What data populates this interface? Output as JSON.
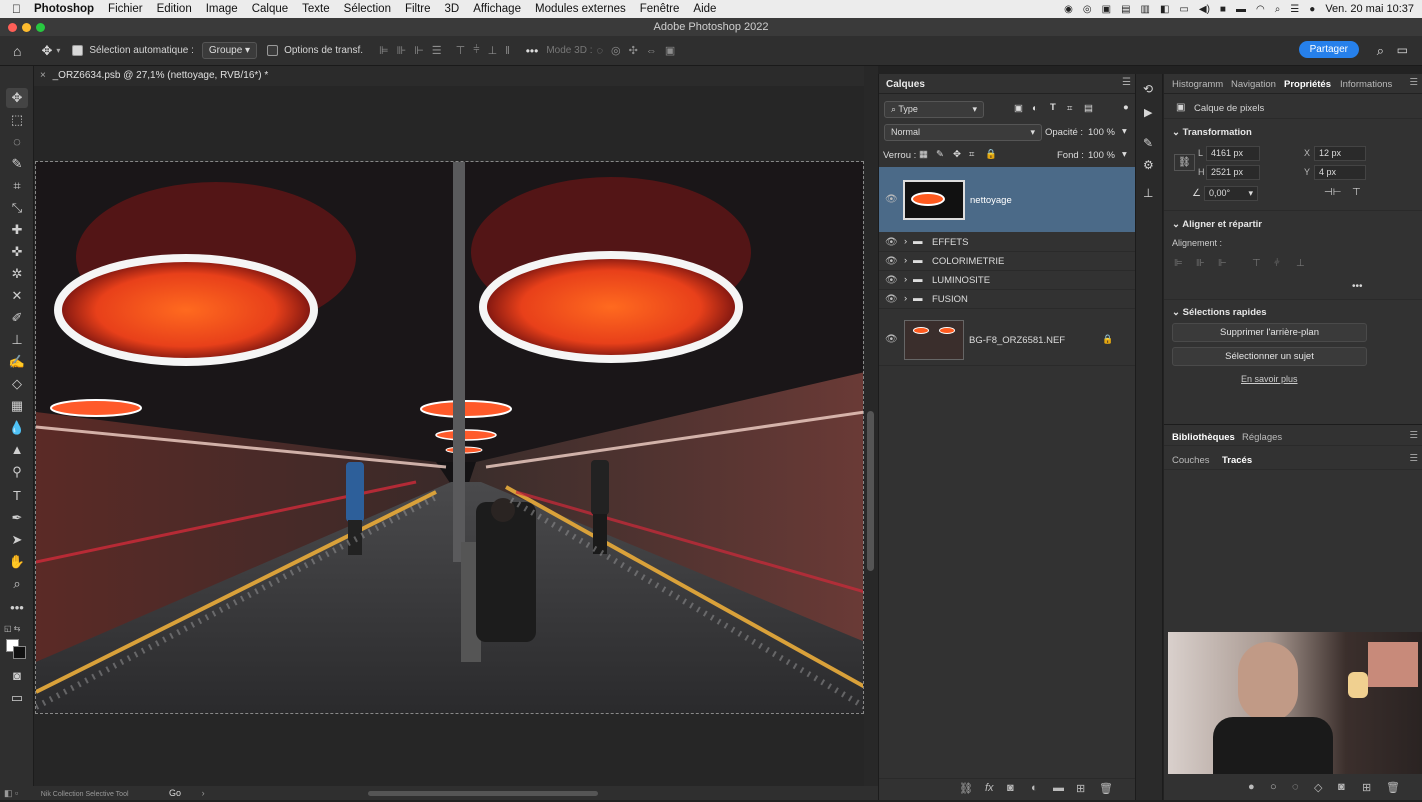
{
  "menubar": {
    "app": "Photoshop",
    "items": [
      "Fichier",
      "Edition",
      "Image",
      "Calque",
      "Texte",
      "Sélection",
      "Filtre",
      "3D",
      "Affichage",
      "Modules externes",
      "Fenêtre",
      "Aide"
    ],
    "datetime": "Ven. 20 mai  10:37"
  },
  "window": {
    "title": "Adobe Photoshop 2022"
  },
  "options": {
    "auto_select_label": "Sélection automatique :",
    "auto_select_value": "Groupe",
    "transform_label": "Options de transf.",
    "mode3d": "Mode 3D :",
    "share": "Partager"
  },
  "document": {
    "tab_title": "_ORZ6634.psb @ 27,1% (nettoyage, RVB/16*) *",
    "status_left": "Nik Collection Selective Tool",
    "status_go": "Go"
  },
  "layers_panel": {
    "title": "Calques",
    "filter": "Type",
    "blend_mode": "Normal",
    "opacity_label": "Opacité :",
    "opacity_value": "100 %",
    "lock_label": "Verrou :",
    "fill_label": "Fond :",
    "fill_value": "100 %",
    "layers": [
      {
        "name": "nettoyage",
        "kind": "pixel",
        "selected": true
      },
      {
        "name": "EFFETS",
        "kind": "group"
      },
      {
        "name": "COLORIMETRIE",
        "kind": "group"
      },
      {
        "name": "LUMINOSITE",
        "kind": "group"
      },
      {
        "name": "FUSION",
        "kind": "group"
      },
      {
        "name": "BG-F8_ORZ6581.NEF",
        "kind": "background",
        "locked": true
      }
    ]
  },
  "properties_panel": {
    "tabs": [
      "Histogramm",
      "Navigation",
      "Propriétés",
      "Informations"
    ],
    "active_tab": "Propriétés",
    "layer_type": "Calque de pixels",
    "transform_title": "Transformation",
    "width_label": "L",
    "width_value": "4161 px",
    "height_label": "H",
    "height_value": "2521 px",
    "x_label": "X",
    "x_value": "12 px",
    "y_label": "Y",
    "y_value": "4 px",
    "angle_value": "0,00°",
    "align_title": "Aligner et répartir",
    "align_label": "Alignement :",
    "quick_title": "Sélections rapides",
    "btn_remove_bg": "Supprimer l'arrière-plan",
    "btn_select_subject": "Sélectionner un sujet",
    "learn_more": "En savoir plus"
  },
  "libraries_panel": {
    "tabs": [
      "Bibliothèques",
      "Réglages"
    ],
    "active": "Bibliothèques"
  },
  "paths_panel": {
    "tabs": [
      "Couches",
      "Tracés"
    ],
    "active": "Tracés"
  },
  "colors": {
    "accent": "#2680eb",
    "selected_layer": "#4b6a88",
    "panel": "#323232"
  }
}
